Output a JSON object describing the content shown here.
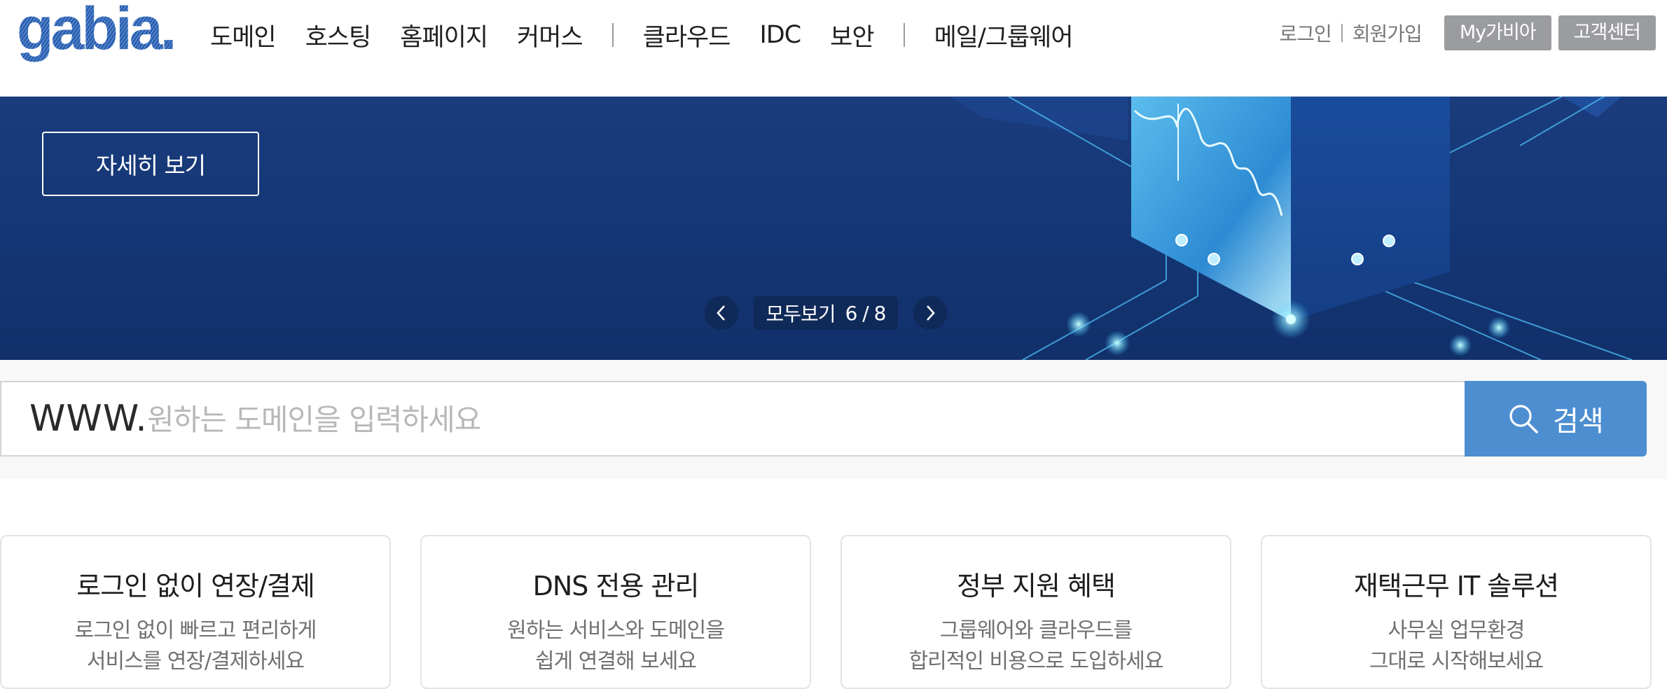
{
  "brand": {
    "logo_text": "gabia."
  },
  "nav": {
    "items": [
      "도메인",
      "호스팅",
      "홈페이지",
      "커머스",
      "클라우드",
      "IDC",
      "보안",
      "메일/그룹웨어"
    ]
  },
  "util": {
    "login": "로그인",
    "signup": "회원가입",
    "my": "My가비아",
    "support": "고객센터"
  },
  "banner": {
    "detail_label": "자세히 보기",
    "all_label": "모두보기",
    "page_count": "6 / 8"
  },
  "search": {
    "prefix": "WWW.",
    "placeholder": "원하는 도메인을 입력하세요",
    "button": "검색"
  },
  "cards": [
    {
      "title": "로그인 없이 연장/결제",
      "line1": "로그인 없이 빠르고 편리하게",
      "line2": "서비스를 연장/결제하세요"
    },
    {
      "title": "DNS 전용 관리",
      "line1": "원하는 서비스와 도메인을",
      "line2": "쉽게 연결해 보세요"
    },
    {
      "title": "정부 지원 혜택",
      "line1": "그룹웨어와 클라우드를",
      "line2": "합리적인 비용으로 도입하세요"
    },
    {
      "title": "재택근무 IT 솔루션",
      "line1": "사무실 업무환경",
      "line2": "그대로 시작해보세요"
    }
  ],
  "colors": {
    "accent": "#4d8ed1",
    "banner": "#163a78",
    "util_button": "#9a9c9f"
  }
}
